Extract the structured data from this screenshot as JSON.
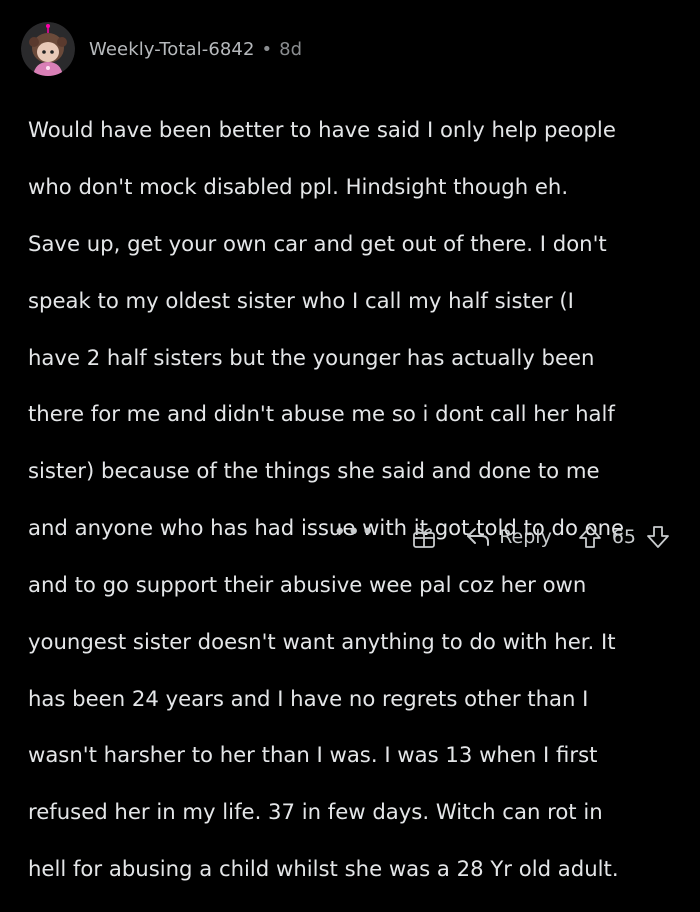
{
  "comment": {
    "author": "Weekly-Total-6842",
    "separator": "•",
    "age": "8d",
    "body_lines": [
      "Would have been better to have said I only help people",
      "who don't mock disabled ppl. Hindsight though eh.",
      "Save up, get your own car and get out of there. I don't",
      "speak to my oldest sister who I call my half sister (I",
      "have 2 half sisters but the younger has actually been",
      "there for me and didn't abuse me so i dont call her half",
      "sister) because of the things she said and done to me",
      "and anyone who has had issue with it got told to do one",
      "and to go support their abusive wee pal coz her own",
      "youngest sister doesn't want anything to do with her. It",
      "has been 24 years and I have no regrets other than I",
      "wasn't harsher to her than I was. I was 13 when I first",
      "refused her in my life. 37 in few days. Witch can rot in",
      "hell for abusing a child whilst she was a 28 Yr old adult."
    ]
  },
  "actions": {
    "more_label": "•••",
    "award_icon": "gift-award-icon",
    "reply_icon": "reply-arrow-icon",
    "reply_label": "Reply",
    "upvote_icon": "upvote-arrow-icon",
    "score": "65",
    "downvote_icon": "downvote-arrow-icon"
  },
  "colors": {
    "background": "#000000",
    "text": "#e4e6e8",
    "muted": "#8a8d90"
  }
}
